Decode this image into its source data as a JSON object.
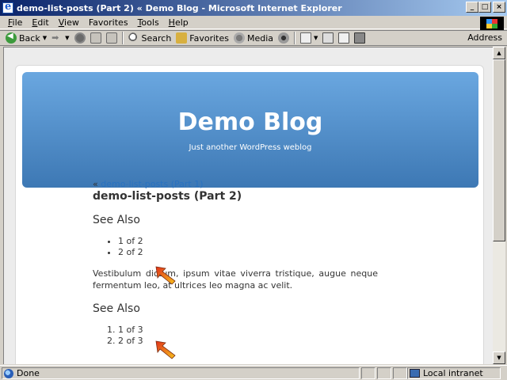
{
  "window": {
    "title": "demo-list-posts (Part 2) « Demo Blog - Microsoft Internet Explorer",
    "controls": [
      "_",
      "□",
      "×"
    ]
  },
  "menubar": [
    {
      "key": "F",
      "rest": "ile"
    },
    {
      "key": "E",
      "rest": "dit"
    },
    {
      "key": "V",
      "rest": "iew"
    },
    {
      "key": "",
      "pre": "F",
      "rest": "avorites",
      "label": "Favorites"
    },
    {
      "key": "T",
      "rest": "ools"
    },
    {
      "key": "H",
      "rest": "elp"
    }
  ],
  "toolbar": {
    "back_label": "Back",
    "search_label": "Search",
    "favorites_label": "Favorites",
    "media_label": "Media",
    "address_label": "Address"
  },
  "header": {
    "blog_title": "Demo Blog",
    "tagline": "Just another WordPress weblog"
  },
  "post": {
    "prev_prefix": "« ",
    "prev_link": "demo-list-posts (Part 1)",
    "title": "demo-list-posts (Part 2)",
    "section1_title": "See Also",
    "list1": [
      "1 of 2",
      "2 of 2"
    ],
    "paragraph": "Vestibulum dictum, ipsum vitae viverra tristique, augue neque fermentum leo, at ultrices leo magna ac velit.",
    "section2_title": "See Also",
    "list2": [
      "1 of 3",
      "2 of 3"
    ]
  },
  "statusbar": {
    "status_text": "Done",
    "zone_text": "Local intranet"
  },
  "colors": {
    "header_top": "#6aa7e0",
    "header_bottom": "#3d78b4",
    "link": "#2a72c0",
    "titlebar": "#0a246a"
  }
}
